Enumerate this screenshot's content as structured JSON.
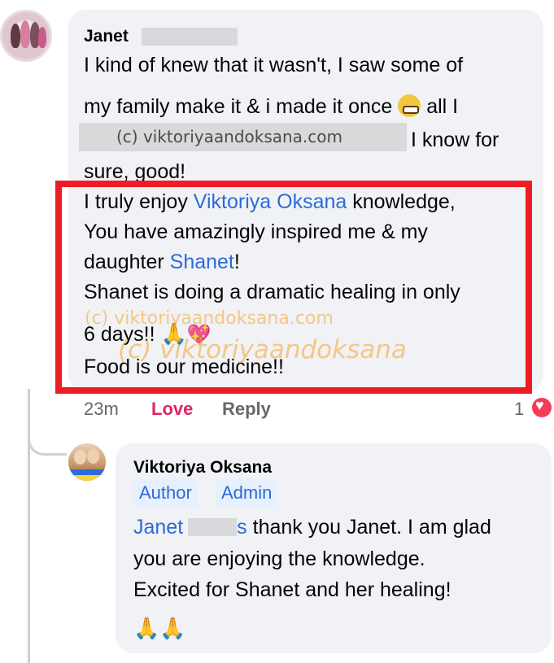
{
  "comment": {
    "author": "Janet",
    "lines": {
      "l1": "I kind of knew that it wasn't, I saw some of",
      "l2a": "my family make it & i made it once",
      "l2b": "all I",
      "l3": "I  know for",
      "l4": "sure, good!",
      "l5a": "I truly enjoy ",
      "l5b": "Viktoriya Oksana",
      "l5c": " knowledge,",
      "l6": "You have amazingly inspired me & my",
      "l7a": "daughter ",
      "l7b": "Shanet",
      "l7c": "!",
      "l8": "Shanet is doing a dramatic healing in only",
      "l9": "6 days!!",
      "l10": "Food is our medicine!!"
    },
    "time": "23m",
    "love_label": "Love",
    "reply_label": "Reply",
    "reaction_count": "1"
  },
  "reply": {
    "author": "Viktoriya Oksana",
    "badges": {
      "author": "Author",
      "admin": "Admin"
    },
    "lines": {
      "l1a": "Janet",
      "l1b": "s",
      "l1c": " thank you Janet. I am glad",
      "l2": "you are enjoying the knowledge.",
      "l3": "Excited for Shanet and her healing!"
    }
  },
  "watermarks": {
    "grey": "(c) viktoriyaandoksana.com",
    "orange1": "(c) viktoriyaandoksana.com",
    "orange2": "(c) viktoriyaandoksana"
  },
  "colors": {
    "link": "#2d6ad9",
    "highlight_box": "#ee1c24",
    "love": "#e0245e",
    "bubble": "#f0f2f5"
  },
  "icons": {
    "grin": "grimacing-face-emoji",
    "hands": "folded-hands-emoji",
    "heart": "sparkling-heart-emoji",
    "reaction": "love-reaction-icon"
  }
}
